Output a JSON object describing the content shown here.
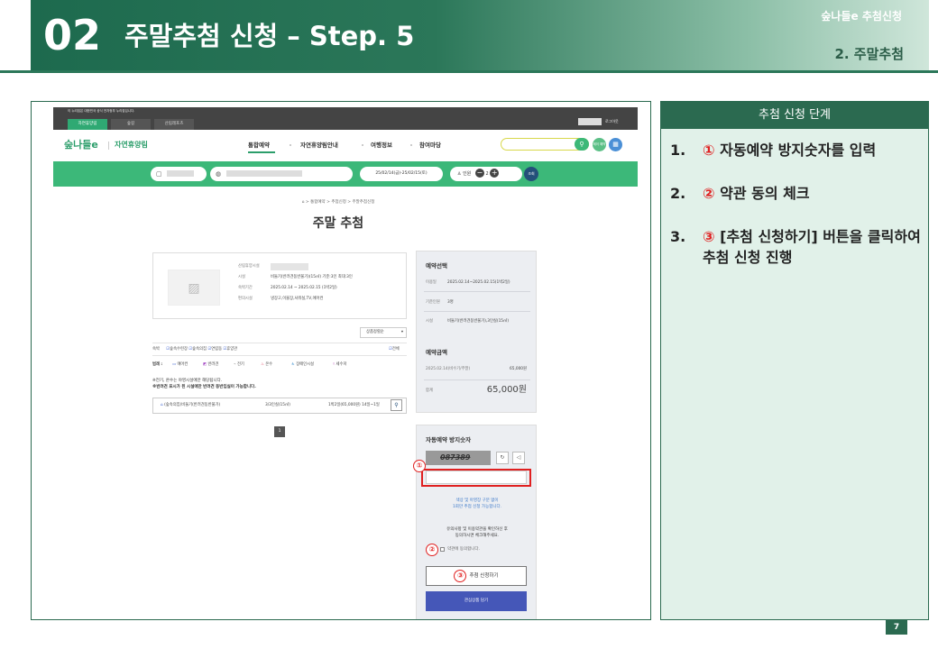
{
  "header": {
    "number": "02",
    "title": "주말추첨 신청 – Step. 5",
    "subtitle": "숲나들e 추첨신청",
    "section": "2. 주말추첨"
  },
  "site": {
    "gov_notice": "이 누리집은 대한민국 공식 전자정부 누리집입니다.",
    "tabs": [
      "자연휴양림",
      "숲길",
      "산림레포츠"
    ],
    "logout": "로그아웃",
    "logo": "숲나들e",
    "logo_sub": "자연휴양림",
    "nav": [
      "통합예약",
      "자연휴양림안내",
      "여행정보",
      "참여마당"
    ],
    "icon_btn1": "제이\n예약하기",
    "date_range": "25/02/14(금)-25/02/15(토)",
    "people_label": "인원",
    "people_count": "2",
    "go_label": "조회"
  },
  "page": {
    "breadcrumb": "⌂ > 통합예약 > 추첨신청 > 주말추첨신청",
    "title": "주말 추첨",
    "facility": {
      "labels": [
        "산림휴양시설",
        "시설",
        "숙박기간",
        "편의시설"
      ],
      "facility_value": "비둘기(반려견동반불가)(15㎡) 기준:3인 최대:3인",
      "period_value": "2025.02.14 ~ 2025.02.15 (1박2일)",
      "amenities_value": "냉장고,이불장,샤워실,TV,에어컨"
    },
    "sort_label": "상품정렬순",
    "checks_label": "숙박",
    "checks": [
      "숲속수련장",
      "숲속의집",
      "연립동",
      "휴양관"
    ],
    "check_all": "전체",
    "legend_label": "범례 :",
    "legend": [
      "에어컨",
      "반려견",
      "전기",
      "온수",
      "장애인시설",
      "세수저"
    ],
    "note1": "※전기, 온수는 야영시설에만 해당됩니다.",
    "note2": "※반려견 표시가 된 시설에만 반려견 동반입실이 가능합니다.",
    "room_name": "(숲속의집)비둘기(반려견동반불가)",
    "room_cap": "3/3인실(15㎡)",
    "room_price": "1박2일(65,000원) 14일~1일",
    "pagination": "1"
  },
  "summary": {
    "title": "예약선택",
    "use_date_label": "이용일",
    "use_date": "2025.02.14~2025.02.15(1박2일)",
    "std_label": "기준인원",
    "std_value": "3명",
    "facility_label": "시설",
    "facility_value": "비둘기(반려견동반불가),3인실(15㎡)",
    "amount_title": "예약금액",
    "amount_line": "2025.02.14(비수기/주말)",
    "amount_line_value": "65,000원",
    "total_label": "합계",
    "total_value": "65,000원"
  },
  "captcha": {
    "title": "자동예약 방지숫자",
    "code": "087389",
    "info": "색상 및 아영장 구분 없이\n1회만 추첨 신청 가능합니다.",
    "terms_info": "유의사항 및 이용약관을 확인하신 후\n동의하시면 체크해주세요.",
    "agree_label": "약관에 동의합니다.",
    "apply_label": "추첨 신청하기",
    "close_label": "관심상품 담기"
  },
  "markers": [
    "①",
    "②",
    "③"
  ],
  "steps": {
    "title": "추첨 신청 단계",
    "items": [
      {
        "num": "1.",
        "circle": "①",
        "text": "자동예약 방지숫자를 입력"
      },
      {
        "num": "2.",
        "circle": "②",
        "text": "약관 동의 체크"
      },
      {
        "num": "3.",
        "circle": "③",
        "text": "[추첨 신청하기] 버튼을 클릭하여 추첨 신청 진행"
      }
    ]
  },
  "page_number": "7",
  "colors": {
    "brand_dark": "#2b6a50",
    "site_green": "#3cb879",
    "marker_red": "#e02020",
    "steps_bg": "#e1f1e9"
  }
}
